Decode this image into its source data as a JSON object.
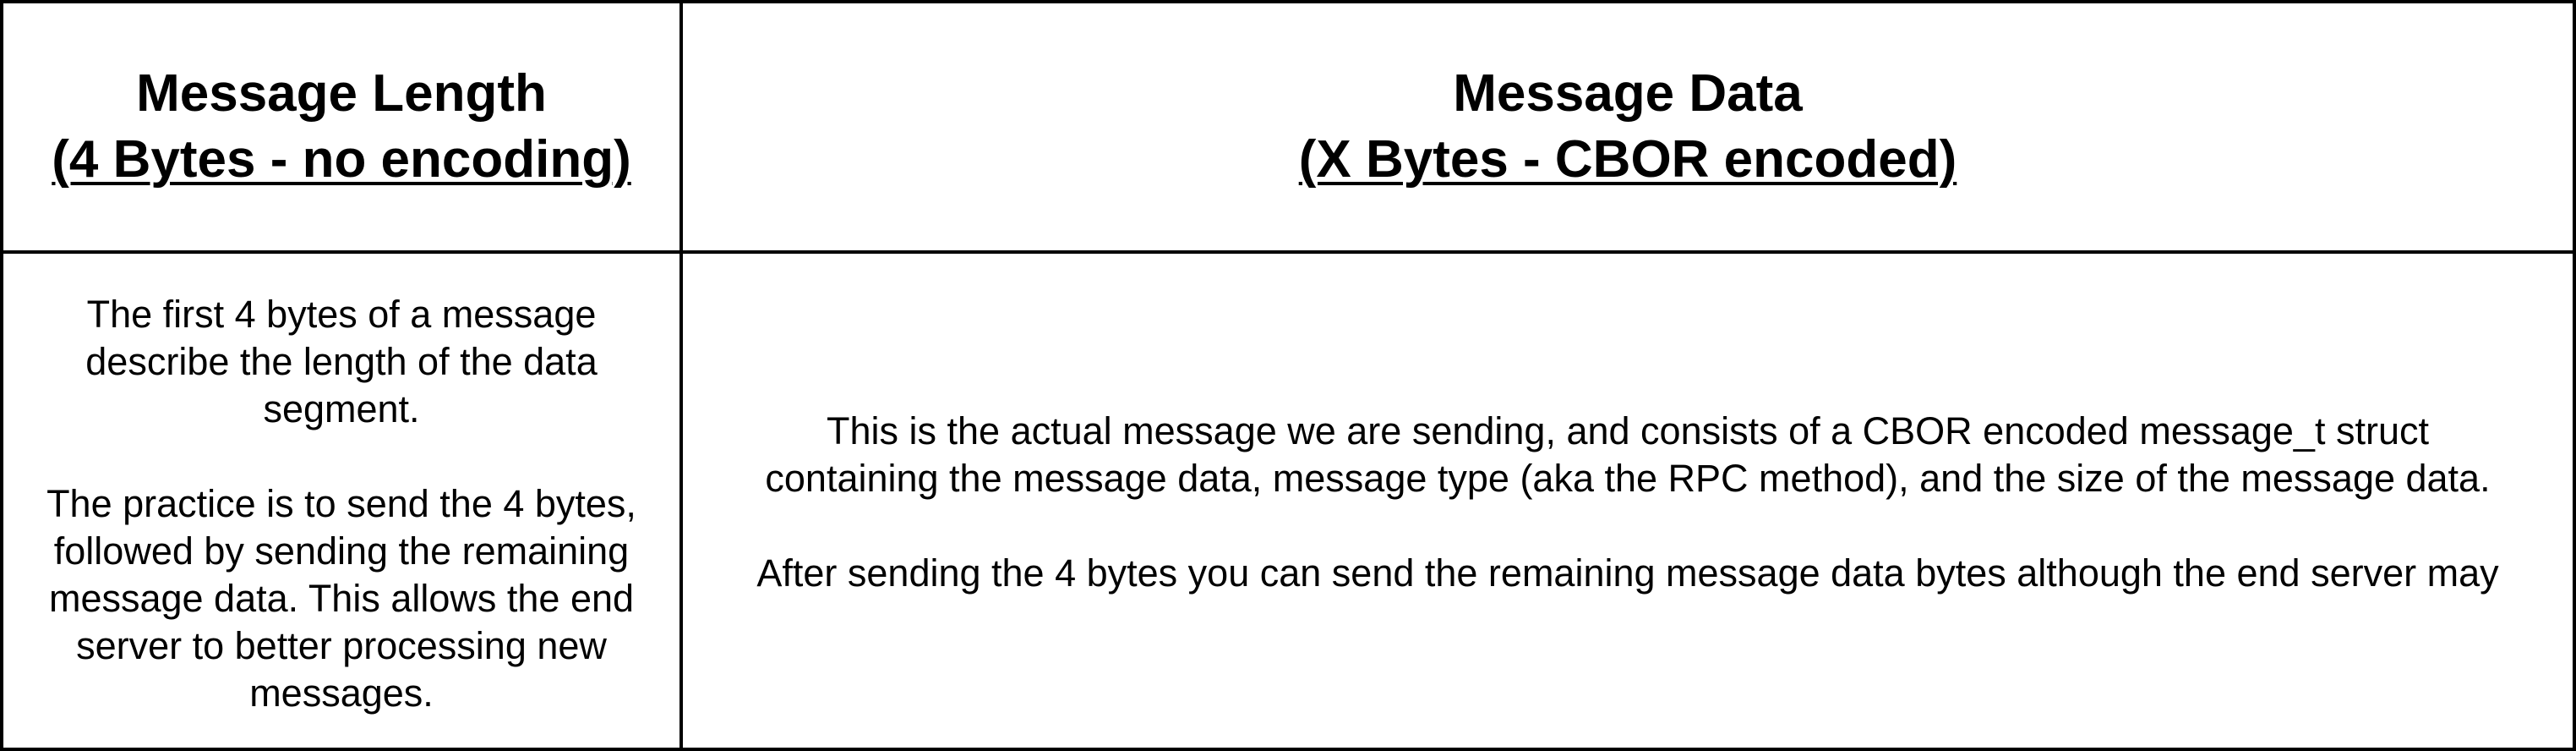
{
  "left_column": {
    "header_line1": "Message Length",
    "header_line2": "(4 Bytes - no encoding)",
    "body_para1": "The first 4 bytes of a message describe the length of the data segment.",
    "body_para2": "The practice is to send the 4 bytes, followed by sending the remaining message data. This allows the end server to better processing new messages."
  },
  "right_column": {
    "header_line1": "Message Data",
    "header_line2": "(X Bytes - CBOR encoded)",
    "body_para1_line1": "This is the actual message we are sending, and consists of a CBOR encoded message_t struct",
    "body_para1_line2": "containing the message data, message type (aka the RPC method), and the size of the message data.",
    "body_para2": "After sending the 4 bytes you can send the remaining message data bytes although the end server may"
  },
  "colors": {
    "border": "#000000",
    "background": "#ffffff",
    "text": "#000000"
  }
}
